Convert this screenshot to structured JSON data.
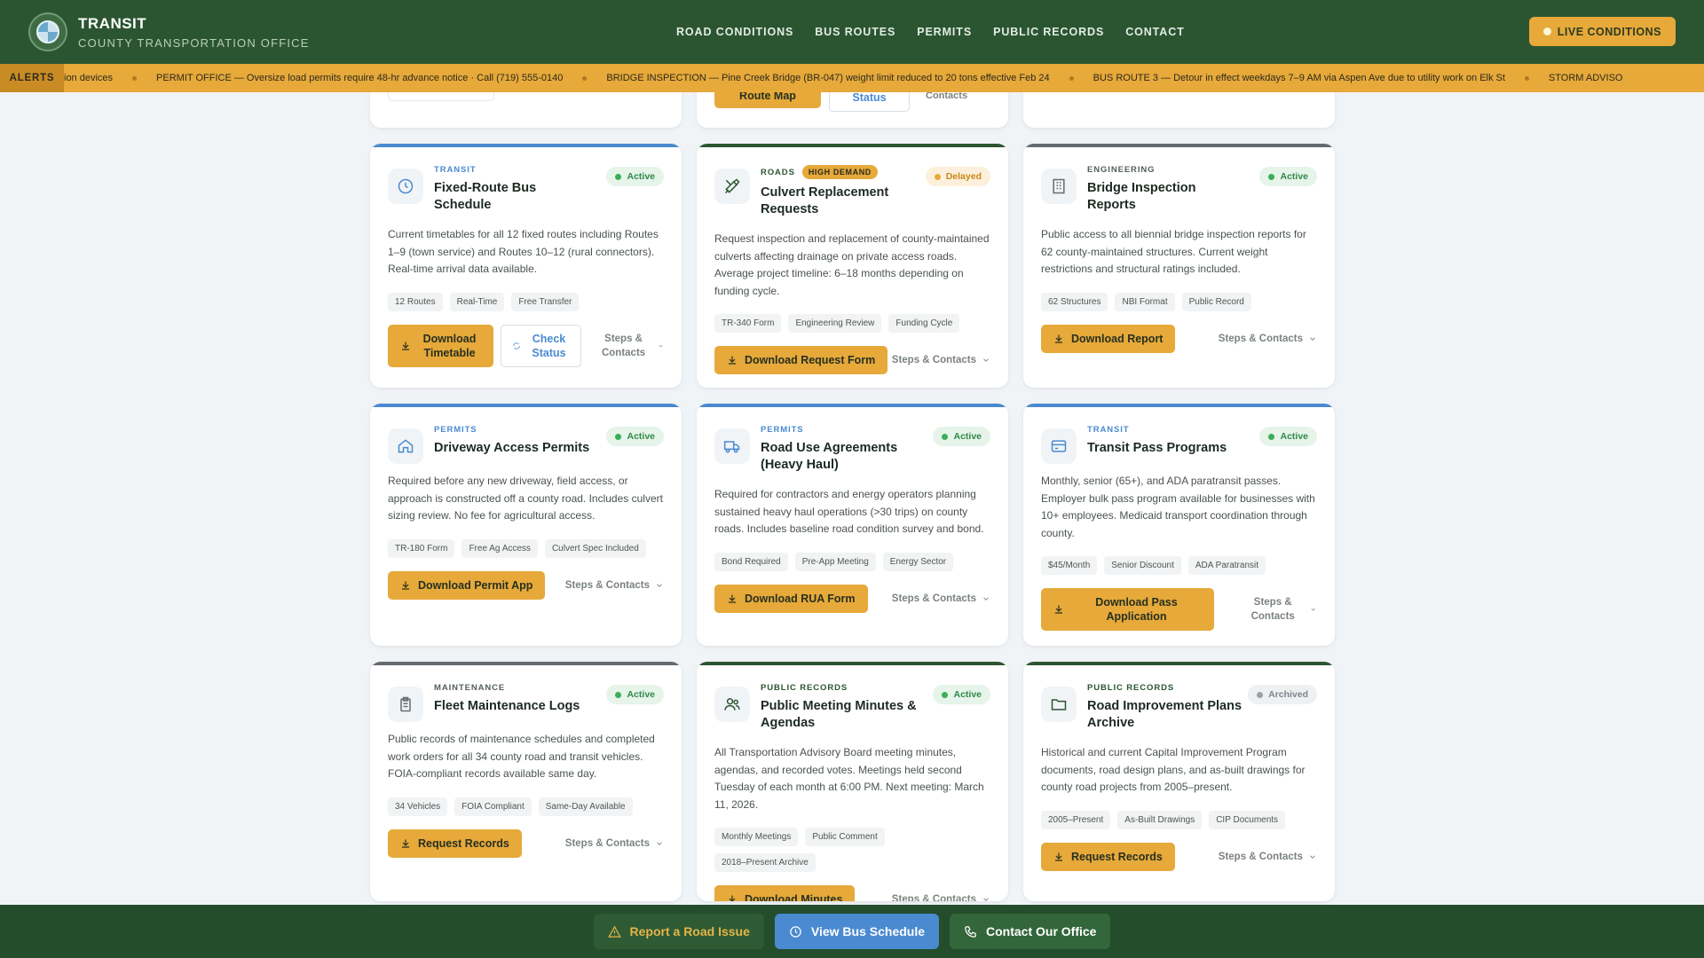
{
  "header": {
    "title": "TRANSIT",
    "subtitle": "COUNTY TRANSPORTATION OFFICE",
    "nav": [
      "ROAD CONDITIONS",
      "BUS ROUTES",
      "PERMITS",
      "PUBLIC RECORDS",
      "CONTACT"
    ],
    "live_label": "LIVE CONDITIONS"
  },
  "alerts": {
    "label": "ALERTS",
    "items": [
      "ion devices",
      "PERMIT OFFICE — Oversize load permits require 48-hr advance notice · Call (719) 555-0140",
      "BRIDGE INSPECTION — Pine Creek Bridge (BR-047) weight limit reduced to 20 tons effective Feb 24",
      "BUS ROUTE 3 — Detour in effect weekdays 7–9 AM via Aspen Ave due to utility work on Elk St",
      "STORM ADVISO"
    ]
  },
  "partial_top": {
    "route_map": "Route Map",
    "status": "Status",
    "contacts": "Contacts"
  },
  "cards": [
    {
      "category": "TRANSIT",
      "title": "Fixed-Route Bus Schedule",
      "status": "Active",
      "desc": "Current timetables for all 12 fixed routes including Routes 1–9 (town service) and Routes 10–12 (rural connectors). Real-time arrival data available.",
      "tags": [
        "12 Routes",
        "Real-Time",
        "Free Transfer"
      ],
      "primary": "Download Timetable",
      "secondary": "Check Status",
      "steps": "Steps & Contacts"
    },
    {
      "category": "ROADS",
      "badge": "HIGH DEMAND",
      "title": "Culvert Replacement Requests",
      "status": "Delayed",
      "desc": "Request inspection and replacement of county-maintained culverts affecting drainage on private access roads. Average project timeline: 6–18 months depending on funding cycle.",
      "tags": [
        "TR-340 Form",
        "Engineering Review",
        "Funding Cycle"
      ],
      "primary": "Download Request Form",
      "steps": "Steps & Contacts"
    },
    {
      "category": "ENGINEERING",
      "title": "Bridge Inspection Reports",
      "status": "Active",
      "desc": "Public access to all biennial bridge inspection reports for 62 county-maintained structures. Current weight restrictions and structural ratings included.",
      "tags": [
        "62 Structures",
        "NBI Format",
        "Public Record"
      ],
      "primary": "Download Report",
      "steps": "Steps & Contacts"
    },
    {
      "category": "PERMITS",
      "title": "Driveway Access Permits",
      "status": "Active",
      "desc": "Required before any new driveway, field access, or approach is constructed off a county road. Includes culvert sizing review. No fee for agricultural access.",
      "tags": [
        "TR-180 Form",
        "Free Ag Access",
        "Culvert Spec Included"
      ],
      "primary": "Download Permit App",
      "steps": "Steps & Contacts"
    },
    {
      "category": "PERMITS",
      "title": "Road Use Agreements (Heavy Haul)",
      "status": "Active",
      "desc": "Required for contractors and energy operators planning sustained heavy haul operations (>30 trips) on county roads. Includes baseline road condition survey and bond.",
      "tags": [
        "Bond Required",
        "Pre-App Meeting",
        "Energy Sector"
      ],
      "primary": "Download RUA Form",
      "steps": "Steps & Contacts"
    },
    {
      "category": "TRANSIT",
      "title": "Transit Pass Programs",
      "status": "Active",
      "desc": "Monthly, senior (65+), and ADA paratransit passes. Employer bulk pass program available for businesses with 10+ employees. Medicaid transport coordination through county.",
      "tags": [
        "$45/Month",
        "Senior Discount",
        "ADA Paratransit"
      ],
      "primary": "Download Pass Application",
      "steps": "Steps & Contacts"
    },
    {
      "category": "MAINTENANCE",
      "title": "Fleet Maintenance Logs",
      "status": "Active",
      "desc": "Public records of maintenance schedules and completed work orders for all 34 county road and transit vehicles. FOIA-compliant records available same day.",
      "tags": [
        "34 Vehicles",
        "FOIA Compliant",
        "Same-Day Available"
      ],
      "primary": "Request Records",
      "steps": "Steps & Contacts"
    },
    {
      "category": "PUBLIC RECORDS",
      "title": "Public Meeting Minutes & Agendas",
      "status": "Active",
      "desc": "All Transportation Advisory Board meeting minutes, agendas, and recorded votes. Meetings held second Tuesday of each month at 6:00 PM. Next meeting: March 11, 2026.",
      "tags": [
        "Monthly Meetings",
        "Public Comment",
        "2018–Present Archive"
      ],
      "primary": "Download Minutes",
      "steps": "Steps & Contacts"
    },
    {
      "category": "PUBLIC RECORDS",
      "title": "Road Improvement Plans Archive",
      "status": "Archived",
      "desc": "Historical and current Capital Improvement Program documents, road design plans, and as-built drawings for county road projects from 2005–present.",
      "tags": [
        "2005–Present",
        "As-Built Drawings",
        "CIP Documents"
      ],
      "primary": "Request Records",
      "steps": "Steps & Contacts"
    }
  ],
  "bottom_bar": {
    "report": "Report a Road Issue",
    "bus": "View Bus Schedule",
    "contact": "Contact Our Office"
  },
  "colors": {
    "header_green": "#2b5531",
    "accent_gold": "#e6a93a",
    "transit_blue": "#4a8ad0",
    "active_green": "#3aae5a"
  }
}
